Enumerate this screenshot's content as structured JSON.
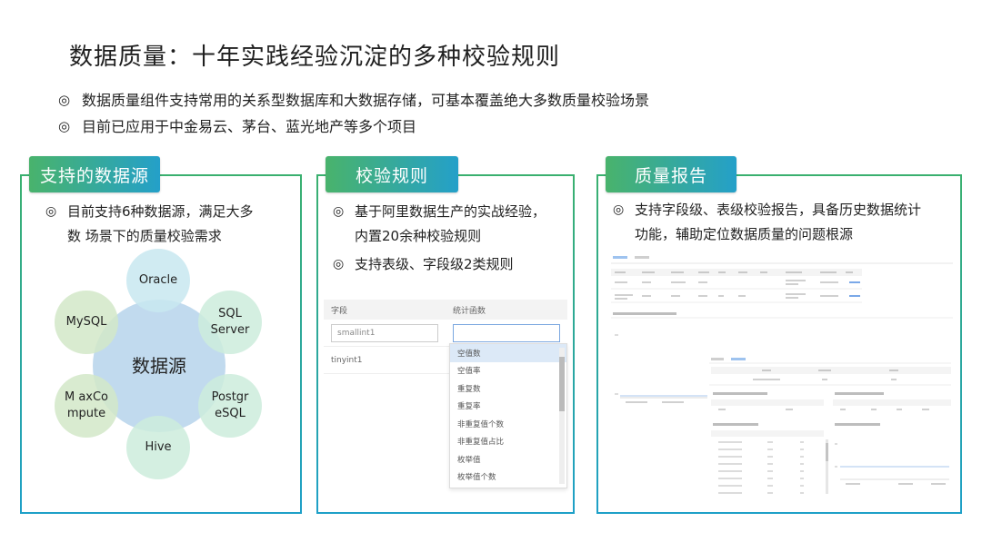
{
  "title": "数据质量：十年实践经验沉淀的多种校验规则",
  "bullet_mark": "◎",
  "bullets": [
    "数据质量组件支持常用的关系型数据库和大数据存储，可基本覆盖绝大多数质量校验场景",
    "目前已应用于中金易云、茅台、蓝光地产等多个项目"
  ],
  "card1": {
    "tag": "支持的数据源",
    "text_line1": "目前支持6种数据源，满足大多",
    "text_line2": "数 场景下的质量校验需求",
    "center": "数据源",
    "nodes": {
      "oracle": "Oracle",
      "sql1": "SQL",
      "sql2": "Server",
      "postgres1": "Postgr",
      "postgres2": "eSQL",
      "hive": "Hive",
      "maxcompute1": "M axCo",
      "maxcompute2": "mpute",
      "mysql": "MySQL"
    }
  },
  "card2": {
    "tag": "校验规则",
    "text1_line1": "基于阿里数据生产的实战经验，",
    "text1_line2": "内置20余种校验规则",
    "text2": "支持表级、字段级2类规则",
    "col_field": "字段",
    "col_func": "统计函数",
    "row1_field": "smallint1",
    "row2_field": "tinyint1",
    "dropdown_options": [
      "空值数",
      "空值率",
      "重复数",
      "重复率",
      "非重复值个数",
      "非重复值占比",
      "枚举值",
      "枚举值个数"
    ]
  },
  "card3": {
    "tag": "质量报告",
    "text_line1": "支持字段级、表级校验报告，具备历史数据统计",
    "text_line2": "功能，辅助定位数据质量的问题根源"
  }
}
